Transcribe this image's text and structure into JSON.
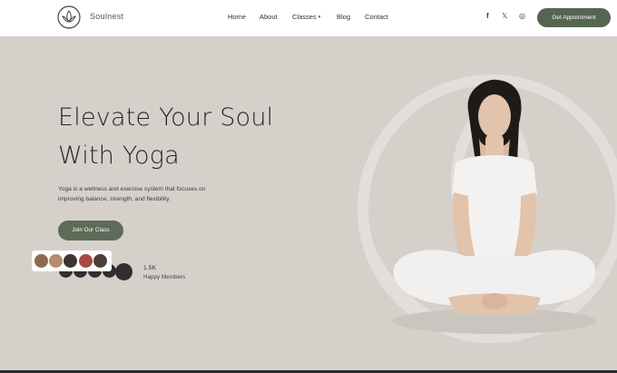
{
  "header": {
    "brand": "Soulnest",
    "logo_icon": "lotus-logo-icon",
    "nav": [
      {
        "label": "Home"
      },
      {
        "label": "About"
      },
      {
        "label": "Classes",
        "caret": "▾"
      },
      {
        "label": "Blog"
      },
      {
        "label": "Contact"
      }
    ],
    "social": [
      {
        "icon": "facebook-icon",
        "glyph": "f"
      },
      {
        "icon": "x-icon",
        "glyph": "𝕏"
      },
      {
        "icon": "instagram-icon",
        "glyph": "◎"
      }
    ],
    "cta_label": "Get Appointment"
  },
  "hero": {
    "title_line1": "Elevate Your Soul",
    "title_line2": "With Yoga",
    "description": "Yoga is a wellness and exercise system that focuses on improving balance, strength, and flexibility.",
    "join_label": "Join Our Class",
    "members_count": "1.5K",
    "members_label": "Happy Members"
  },
  "colors": {
    "accent": "#55654f",
    "background": "#d6d0cb",
    "header_bg": "#ffffff"
  }
}
